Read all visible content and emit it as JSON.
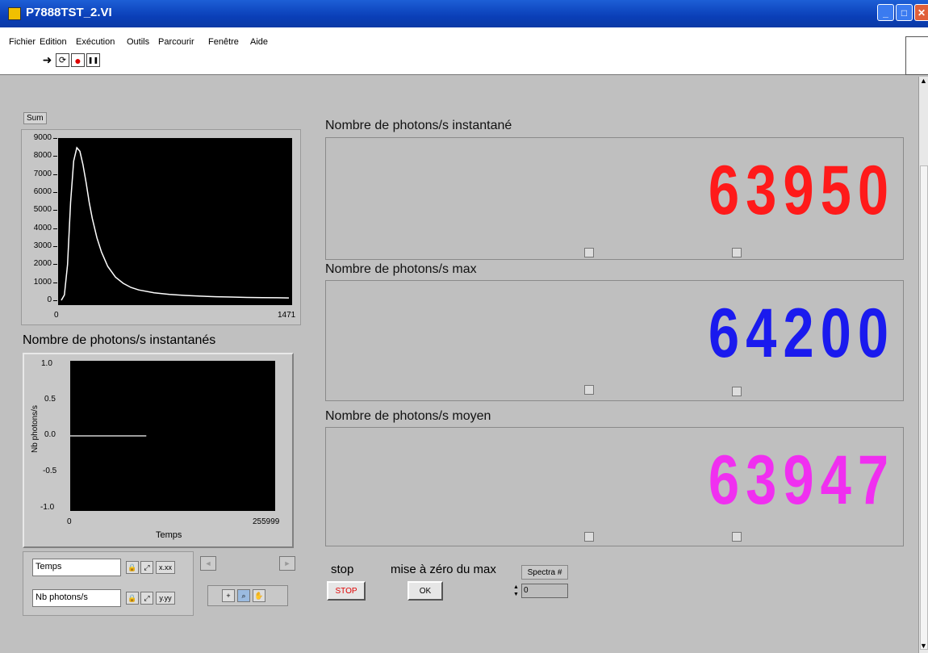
{
  "window": {
    "title": "P7888TST_2.VI"
  },
  "menu": [
    "Fichier",
    "Edition",
    "Exécution",
    "Outils",
    "Parcourir",
    "Fenêtre",
    "Aide"
  ],
  "toolbar": {
    "icons": [
      "run-arrow-icon",
      "run-continuous-icon",
      "abort-icon",
      "pause-icon"
    ],
    "glyphs": [
      "➜",
      "⟳",
      "●",
      "❚❚"
    ]
  },
  "sum_graph": {
    "button_label": "Sum",
    "y_ticks": [
      "9000",
      "8000",
      "7000",
      "6000",
      "5000",
      "4000",
      "3000",
      "2000",
      "1000",
      "0"
    ],
    "x_ticks": [
      "0",
      "1471"
    ]
  },
  "chart_data": [
    {
      "type": "line",
      "title": "",
      "xlabel": "",
      "ylabel": "",
      "xlim": [
        0,
        1471
      ],
      "ylim": [
        0,
        9000
      ],
      "grid": false,
      "series": [
        {
          "x": [
            0,
            20,
            40,
            60,
            80,
            100,
            120,
            140,
            160,
            180,
            200,
            230,
            260,
            300,
            350,
            400,
            450,
            500,
            600,
            700,
            800,
            900,
            1000,
            1100,
            1200,
            1300,
            1400,
            1471
          ],
          "y": [
            0,
            300,
            2000,
            5500,
            7800,
            8550,
            8350,
            7600,
            6600,
            5500,
            4600,
            3500,
            2700,
            1900,
            1300,
            950,
            720,
            580,
            420,
            330,
            270,
            230,
            200,
            180,
            160,
            150,
            140,
            130
          ],
          "color": "#ffffff"
        }
      ]
    },
    {
      "type": "line",
      "title": "Nombre de photons/s instantanés",
      "xlabel": "Temps",
      "ylabel": "Nb photons/s",
      "xlim": [
        0,
        255999
      ],
      "ylim": [
        -1.0,
        1.0
      ],
      "grid": false,
      "x_ticks": [
        "0",
        "255999"
      ],
      "y_ticks": [
        "1.0",
        "0.5",
        "0.0",
        "-0.5",
        "-1.0"
      ],
      "series": [
        {
          "x": [
            0,
            95000
          ],
          "y": [
            0.0,
            0.0
          ],
          "color": "#d0d0d0"
        }
      ]
    }
  ],
  "palette": {
    "x_name": "Temps",
    "y_name": "Nb photons/s",
    "x_fmt": "x.xx",
    "y_fmt": "y.yy"
  },
  "displays": [
    {
      "label": "Nombre de photons/s instantané",
      "value": "63950",
      "color": "#ff1a1a"
    },
    {
      "label": "Nombre de photons/s max",
      "value": "64200",
      "color": "#1a1aee"
    },
    {
      "label": "Nombre de photons/s moyen",
      "value": "63947",
      "color": "#f02ff0"
    }
  ],
  "controls": {
    "stop_label": "stop",
    "stop_button": "STOP",
    "reset_label": "mise à zéro du max",
    "ok_button": "OK",
    "spectra_label": "Spectra #",
    "spectra_value": "0"
  }
}
